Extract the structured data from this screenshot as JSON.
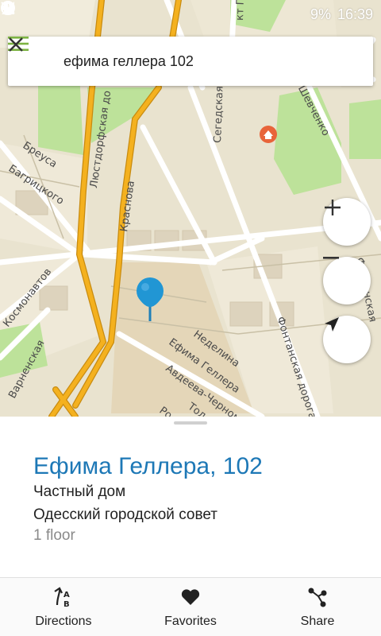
{
  "status_bar": {
    "battery_percent": "9%",
    "time": "16:39"
  },
  "search": {
    "query": "ефима геллера 102"
  },
  "map": {
    "streets": {
      "breusa": "Бреуса",
      "bagritskogo": "Багрицкого",
      "lyustdorfskaya": "Люстдорфская до",
      "krasnova": "Краснова",
      "segedskaya": "Сегедская",
      "gagarina": "кт Гагарина",
      "shevchenko": "т Шевченко",
      "kosmonavtov": "Космонавтов",
      "varnenskaya": "Варненская",
      "nedelina": "Неделина",
      "yefima_gellera": "Ефима Геллера",
      "avdeeva": "Авдеева-Черноморс",
      "tol": "Тол",
      "rom": "Ро",
      "fontanskaya": "Фонтанская дорога",
      "fontanskaya2": "Фонтанская"
    }
  },
  "controls": {
    "zoom_in": "+",
    "zoom_out": "−"
  },
  "place": {
    "title": "Ефима Геллера, 102",
    "type": "Частный дом",
    "council": "Одесский городской совет",
    "floors": "1 floor"
  },
  "bottom_nav": {
    "directions": "Directions",
    "favorites": "Favorites",
    "share": "Share"
  },
  "colors": {
    "accent_blue": "#1d78b6",
    "road_yellow": "#f4b11f",
    "map_green": "#bde29a",
    "map_bg": "#e9e3cf",
    "menu_green": "#7cb342"
  }
}
